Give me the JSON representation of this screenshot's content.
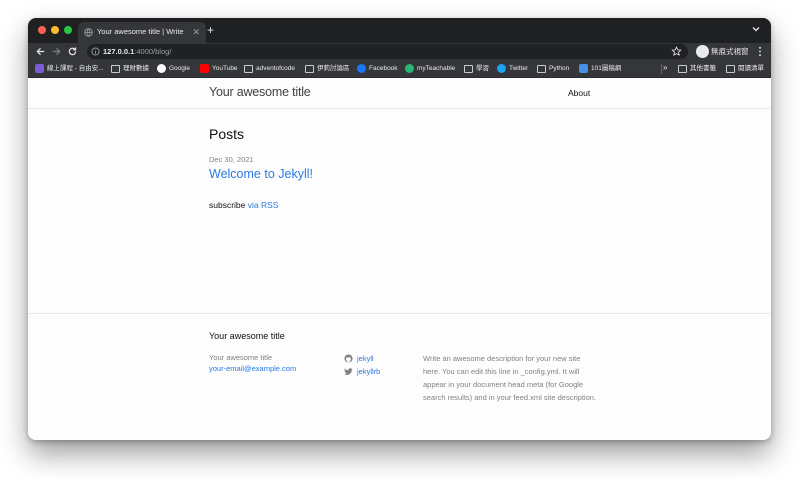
{
  "browser": {
    "tab_title": "Your awesome title | Write an awesome description",
    "url_host": "127.0.0.1",
    "url_rest": ":4000/blog/",
    "profile_label": "無痕式視窗",
    "bookmarks": [
      {
        "label": "線上課程 - 自由安...",
        "color": "#7b5cd6"
      },
      {
        "label": "理財數據",
        "color": "folder"
      },
      {
        "label": "Google",
        "color": "#ffffff"
      },
      {
        "label": "YouTube",
        "color": "#ff0000"
      },
      {
        "label": "adventofcode",
        "color": "folder"
      },
      {
        "label": "伊莉討論區",
        "color": "folder"
      },
      {
        "label": "Facebook",
        "color": "#1877f2"
      },
      {
        "label": "myTeachable",
        "color": "#2bb673"
      },
      {
        "label": "學習",
        "color": "folder"
      },
      {
        "label": "Twitter",
        "color": "#1da1f2"
      },
      {
        "label": "Python",
        "color": "folder"
      },
      {
        "label": "101圖稿網",
        "color": "#4a8fe7"
      }
    ],
    "bookmarks_more": "»",
    "other_bookmarks": "其他書籤",
    "reading_list": "閱讀清單"
  },
  "site": {
    "title": "Your awesome title",
    "nav_about": "About"
  },
  "main": {
    "heading": "Posts",
    "post_date": "Dec 30, 2021",
    "post_title": "Welcome to Jekyll!",
    "subscribe_prefix": "subscribe",
    "subscribe_link": "via RSS"
  },
  "footer": {
    "heading": "Your awesome title",
    "name": "Your awesome title",
    "email": "your-email@example.com",
    "github": "jekyll",
    "twitter": "jekyllrb",
    "description": "Write an awesome description for your new site here. You can edit this line in _config.yml. It will appear in your document head meta (for Google search results) and in your feed.xml site description."
  }
}
